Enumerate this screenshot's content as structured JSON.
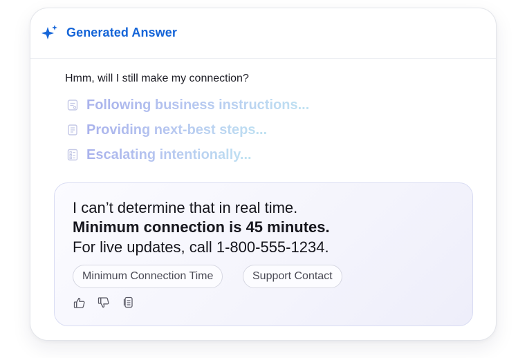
{
  "header": {
    "title": "Generated Answer",
    "icon": "sparkle-icon",
    "accent_color": "#1565d8"
  },
  "question": "Hmm, will I still make my connection?",
  "steps": [
    {
      "icon": "document-list-icon",
      "label": "Following business instructions..."
    },
    {
      "icon": "document-lines-icon",
      "label": "Providing next-best steps..."
    },
    {
      "icon": "checklist-icon",
      "label": "Escalating intentionally..."
    }
  ],
  "answer": {
    "line1": "I can’t determine that in real time.",
    "line2": "Minimum connection is 45 minutes.",
    "line3": "For live updates, call 1-800-555-1234.",
    "chips": [
      "Minimum Connection Time",
      "Support Contact"
    ],
    "feedback_icons": [
      "thumbs-up-icon",
      "thumbs-down-icon",
      "copy-icon"
    ]
  }
}
